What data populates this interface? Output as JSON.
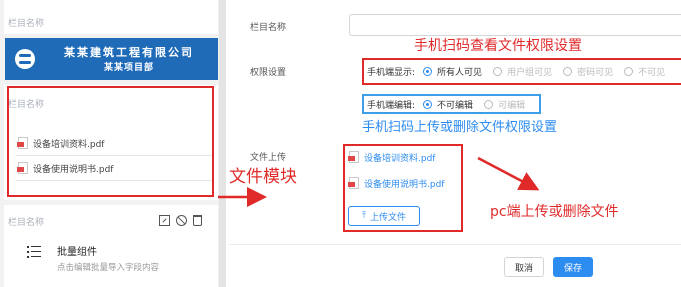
{
  "left_panel": {
    "top_card_title": "栏目名称",
    "banner": {
      "company": "某某建筑工程有限公司",
      "project": "某某项目部"
    },
    "file_card": {
      "title": "栏目名称",
      "files": [
        {
          "name": "设备培训资料.pdf",
          "icon": "pdf-icon"
        },
        {
          "name": "设备使用说明书.pdf",
          "icon": "pdf-icon"
        }
      ]
    },
    "batch_card": {
      "title": "栏目名称",
      "tool_icons": [
        "expand-icon",
        "ban-icon",
        "trash-icon"
      ],
      "batch_title": "批量组件",
      "batch_sub": "点击编辑批量导入字段内容"
    }
  },
  "form": {
    "name_label": "栏目名称",
    "name_value": "",
    "permission_label": "权限设置",
    "mobile_display": {
      "label": "手机端显示:",
      "options": [
        "所有人可见",
        "用户组可见",
        "密码可见",
        "不可见"
      ],
      "selected": "所有人可见"
    },
    "mobile_edit": {
      "label": "手机端编辑:",
      "options": [
        "不可编辑",
        "可编辑"
      ],
      "selected": "不可编辑"
    },
    "upload_label": "文件上传",
    "uploaded_files": [
      "设备培训资料.pdf",
      "设备使用说明书.pdf"
    ],
    "upload_button": "上传文件",
    "cancel": "取消",
    "save": "保存"
  },
  "annotations": {
    "mobile_view_permission": "手机扫码查看文件权限设置",
    "mobile_edit_permission": "手机扫码上传或删除文件权限设置",
    "file_module": "文件模块",
    "pc_upload": "pc端上传或删除文件"
  },
  "colors": {
    "accent": "#2d8cf0",
    "banner": "#1f6bb8",
    "annotation_red": "#e02a2a",
    "annotation_blue": "#2d8cf0"
  }
}
